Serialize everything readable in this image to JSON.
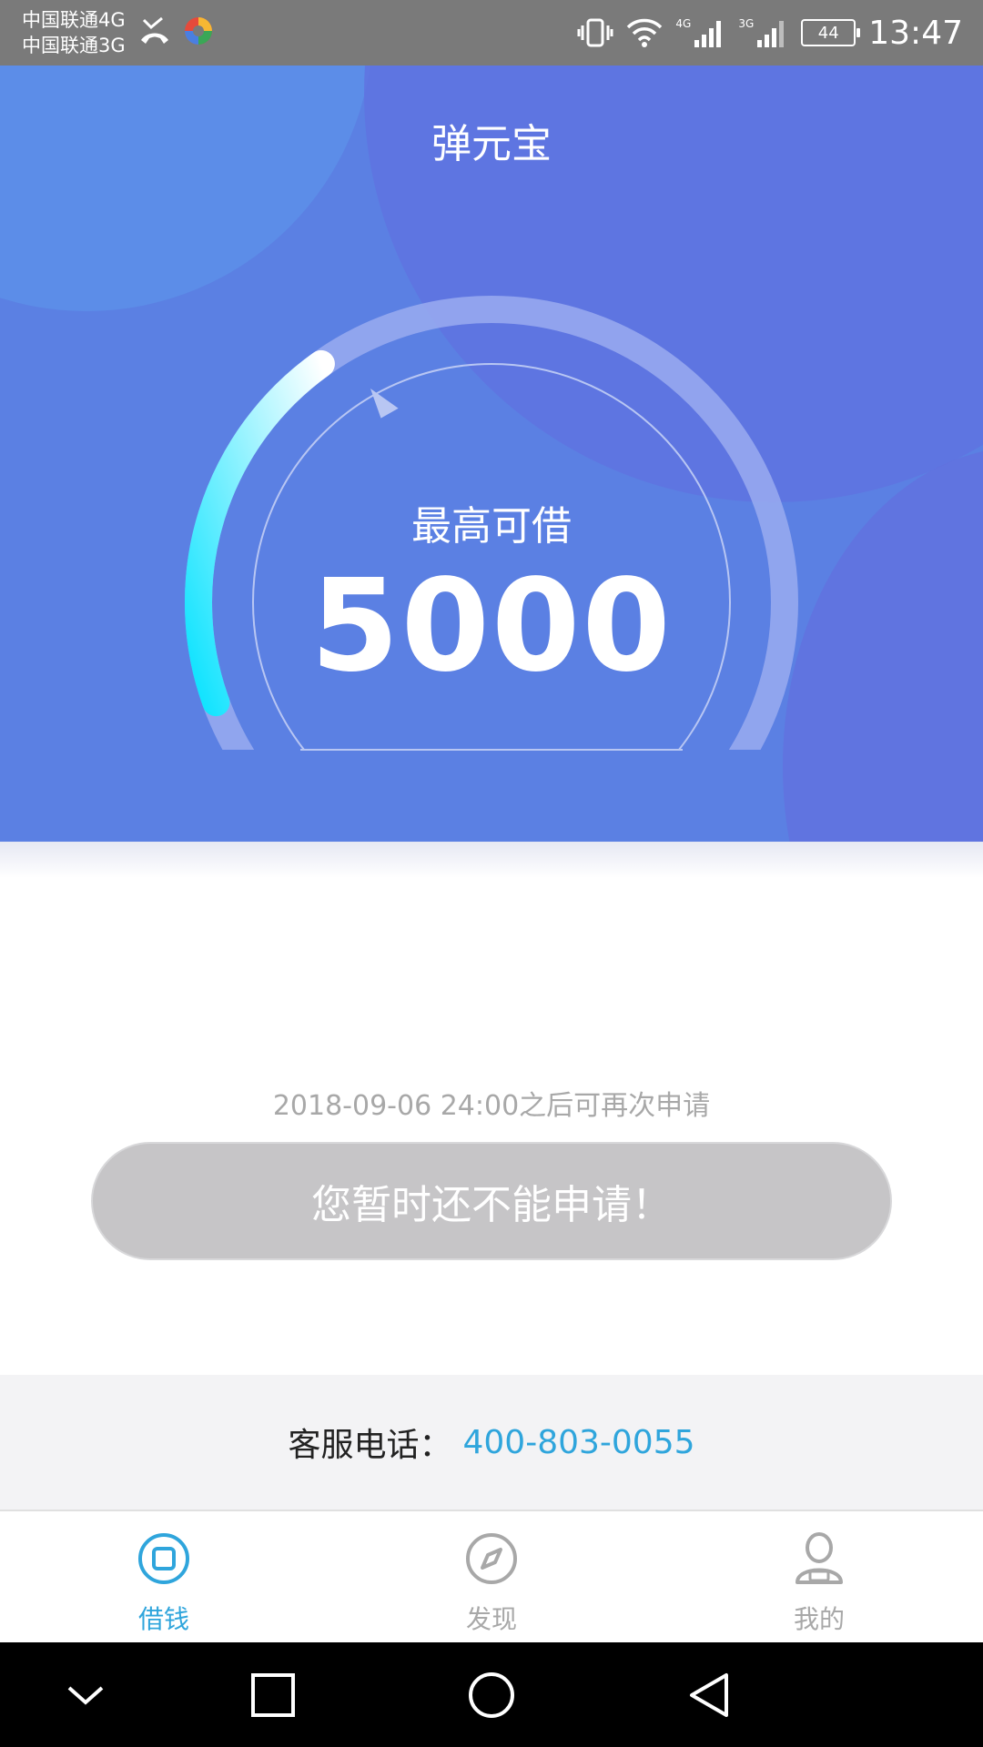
{
  "status_bar": {
    "carrier_1": "中国联通4G",
    "carrier_2": "中国联通3G",
    "net_1": "4G",
    "net_2": "3G",
    "battery": "44",
    "time": "13:47"
  },
  "header": {
    "title": "弹元宝"
  },
  "gauge": {
    "label": "最高可借",
    "value": "5000",
    "fill_fraction": 0.38
  },
  "apply": {
    "reapply_notice": "2018-09-06 24:00之后可再次申请",
    "button_label": "您暂时还不能申请！"
  },
  "service": {
    "label": "客服电话：",
    "phone": "400-803-0055"
  },
  "tabs": [
    {
      "label": "借钱",
      "icon": "square-circle-icon"
    },
    {
      "label": "发现",
      "icon": "compass-icon"
    },
    {
      "label": "我的",
      "icon": "user-icon"
    }
  ],
  "colors": {
    "accent": "#2fa5dc",
    "hero": "#5b80e3",
    "button_disabled": "#c6c5c7"
  }
}
